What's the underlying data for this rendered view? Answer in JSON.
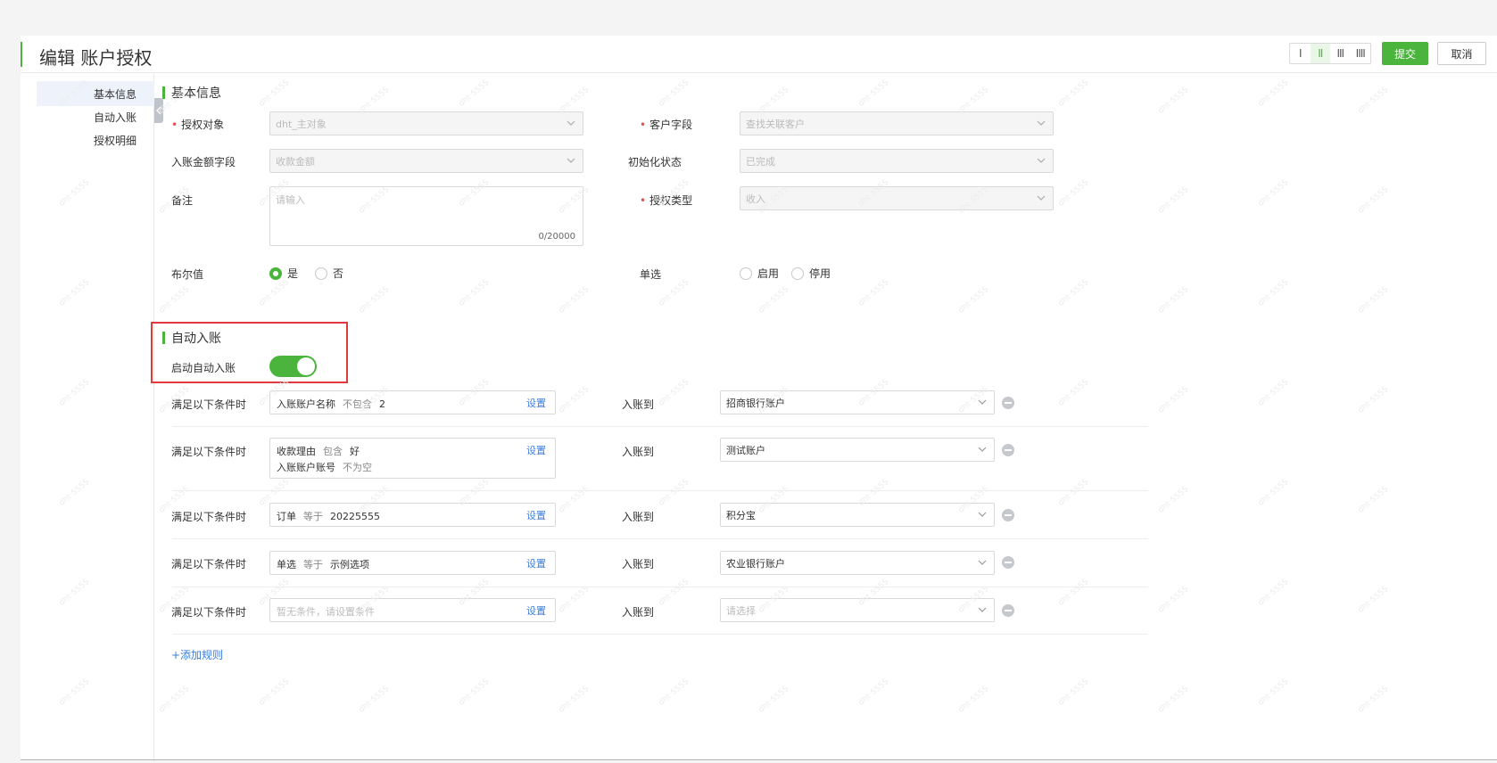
{
  "header": {
    "title": "编辑 账户授权",
    "column_buttons": [
      "I",
      "II",
      "III",
      "IIII"
    ],
    "active_column": 1,
    "submit_label": "提交",
    "cancel_label": "取消"
  },
  "sidebar": {
    "items": [
      {
        "label": "基本信息",
        "active": true
      },
      {
        "label": "自动入账",
        "active": false
      },
      {
        "label": "授权明细",
        "active": false
      }
    ]
  },
  "basic": {
    "section_title": "基本信息",
    "auth_object": {
      "label": "授权对象",
      "required": true,
      "value": "dht_主对象"
    },
    "customer_field": {
      "label": "客户字段",
      "required": true,
      "value": "查找关联客户"
    },
    "amount_field": {
      "label": "入账金额字段",
      "value": "收款金额"
    },
    "init_status": {
      "label": "初始化状态",
      "value": "已完成"
    },
    "remark": {
      "label": "备注",
      "placeholder": "请输入",
      "count": "0/20000"
    },
    "auth_type": {
      "label": "授权类型",
      "required": true,
      "value": "收入"
    },
    "boolean": {
      "label": "布尔值",
      "options": [
        "是",
        "否"
      ],
      "selected": "是"
    },
    "single": {
      "label": "单选",
      "options": [
        "启用",
        "停用"
      ]
    }
  },
  "auto": {
    "section_title": "自动入账",
    "toggle_label": "启动自动入账",
    "toggle_on": true,
    "rules": [
      {
        "label": "满足以下条件时",
        "conditions": [
          {
            "field": "入账账户名称",
            "op": "不包含",
            "value": "2"
          }
        ],
        "set_label": "设置",
        "target_label": "入账到",
        "target": "招商银行账户"
      },
      {
        "label": "满足以下条件时",
        "conditions": [
          {
            "field": "收款理由",
            "op": "包含",
            "value": "好"
          },
          {
            "field": "入账账户账号",
            "op": "不为空",
            "value": ""
          }
        ],
        "set_label": "设置",
        "target_label": "入账到",
        "target": "测试账户"
      },
      {
        "label": "满足以下条件时",
        "conditions": [
          {
            "field": "订单",
            "op": "等于",
            "value": "20225555"
          }
        ],
        "set_label": "设置",
        "target_label": "入账到",
        "target": "积分宝"
      },
      {
        "label": "满足以下条件时",
        "conditions": [
          {
            "field": "单选",
            "op": "等于",
            "value": "示例选项"
          }
        ],
        "set_label": "设置",
        "target_label": "入账到",
        "target": "农业银行账户"
      },
      {
        "label": "满足以下条件时",
        "empty_text": "暂无条件，请设置条件",
        "set_label": "设置",
        "target_label": "入账到",
        "target_placeholder": "请选择"
      }
    ],
    "add_rule_label": "+添加规则"
  },
  "watermark": "dht 5555",
  "colors": {
    "accent": "#4ab43c",
    "link": "#3b7ddd",
    "highlight_box": "#e0393e"
  }
}
